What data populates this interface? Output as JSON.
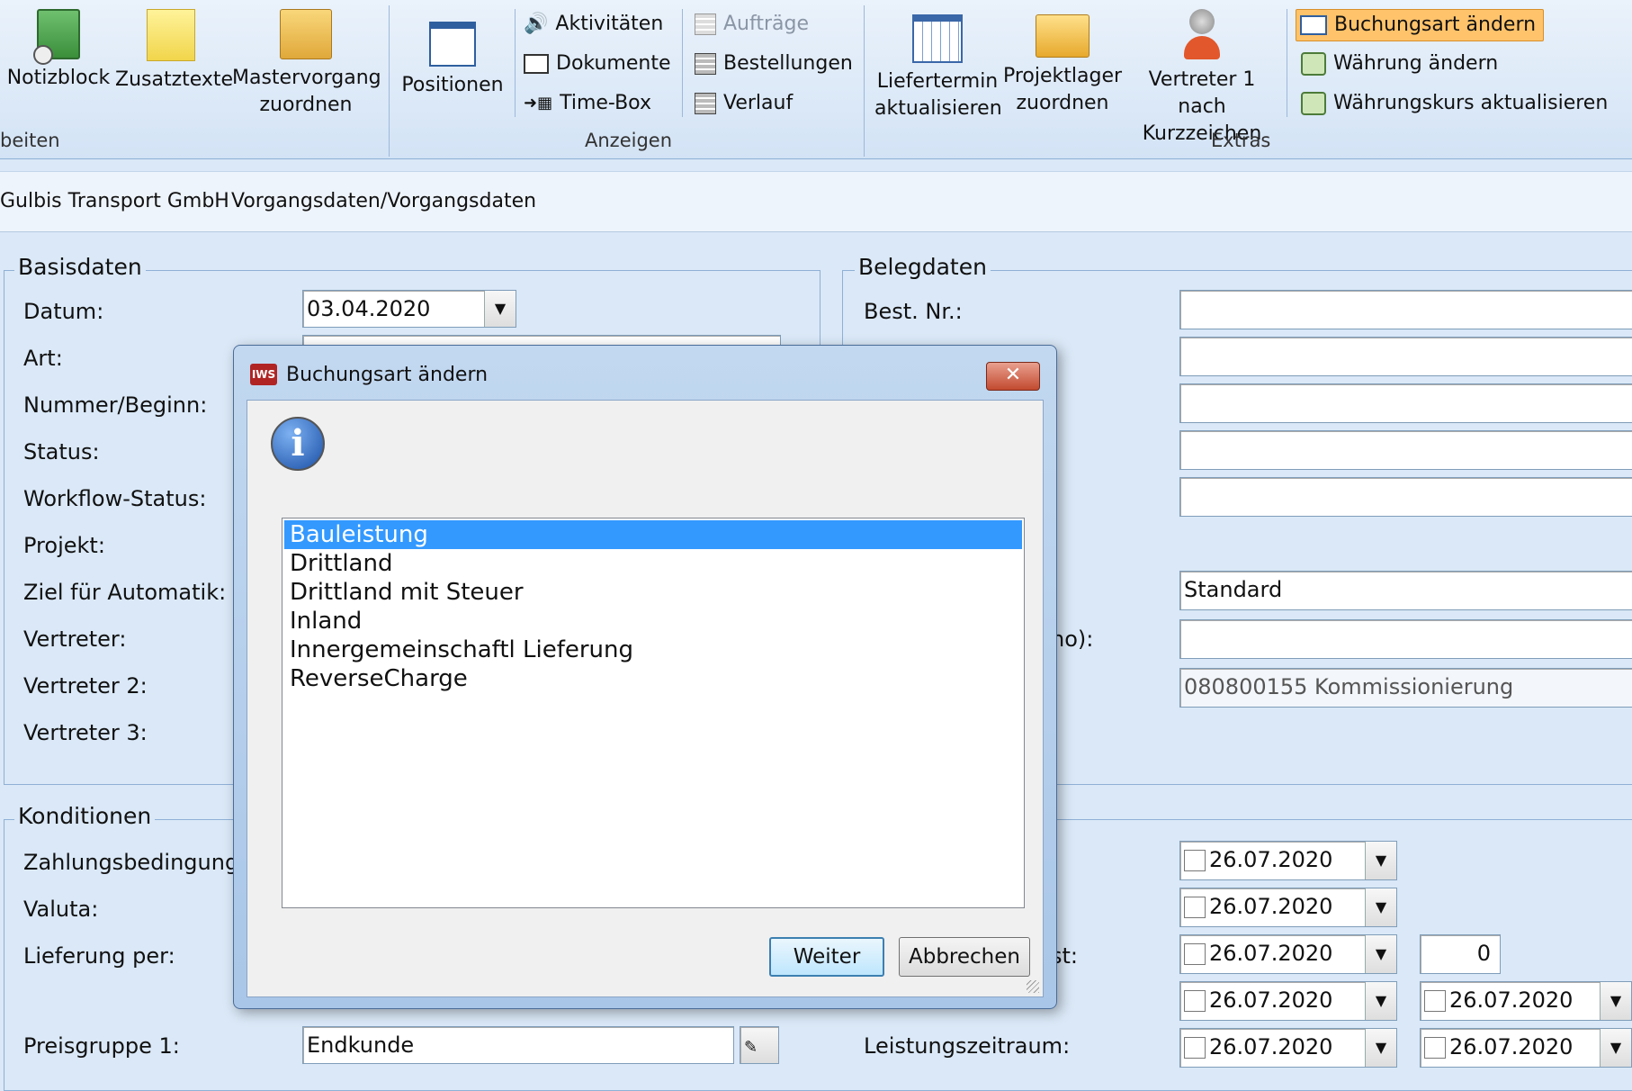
{
  "ribbon": {
    "large": {
      "notizblock": "Notizblock",
      "zusatztexte": "Zusatztexte",
      "mastervorgang_l1": "Mastervorgang",
      "mastervorgang_l2": "zuordnen",
      "positionen": "Positionen",
      "liefertermin_l1": "Liefertermin",
      "liefertermin_l2": "aktualisieren",
      "projektlager_l1": "Projektlager",
      "projektlager_l2": "zuordnen",
      "vertreter_l1": "Vertreter 1 nach",
      "vertreter_l2": "Kurzzeichen"
    },
    "anzeigen": {
      "aktivitaeten": "Aktivitäten",
      "dokumente": "Dokumente",
      "timebox": "Time-Box",
      "auftraege": "Aufträge",
      "bestellungen": "Bestellungen",
      "verlauf": "Verlauf"
    },
    "extras": {
      "buchungsart": "Buchungsart ändern",
      "waehrung": "Währung ändern",
      "waehrungskurs": "Währungskurs aktualisieren"
    },
    "groups": {
      "bearbeiten": "beiten",
      "anzeigen": "Anzeigen",
      "extras": "Extras"
    }
  },
  "breadcrumb": {
    "company": "Gulbis Transport GmbH",
    "path": "Vorgangsdaten/Vorgangsdaten"
  },
  "basisdaten": {
    "title": "Basisdaten",
    "labels": [
      "Datum:",
      "Art:",
      "Nummer/Beginn:",
      "Status:",
      "Workflow-Status:",
      "Projekt:",
      "Ziel für Automatik:",
      "Vertreter:",
      "Vertreter 2:",
      "Vertreter 3:"
    ],
    "datum": "03.04.2020"
  },
  "belegdaten": {
    "title": "Belegdaten",
    "best_nr": "Best. Nr.:",
    "partial_label": "no):",
    "standard": "Standard",
    "kommission": "080800155 Kommissionierung"
  },
  "konditionen": {
    "title": "Konditionen",
    "labels": [
      "Zahlungsbedingung:",
      "Valuta:",
      "Lieferung per:",
      "Preisgruppe 1:"
    ],
    "preisgruppe": "Endkunde",
    "partial_label": "st:",
    "leistungszeitraum": "Leistungszeitraum:",
    "dates": [
      "26.07.2020",
      "26.07.2020",
      "26.07.2020",
      "26.07.2020",
      "26.07.2020"
    ],
    "right_dates": [
      "26.07.2020",
      "26.07.2020"
    ],
    "zero": "0"
  },
  "dialog": {
    "title": "Buchungsart ändern",
    "options": [
      "Bauleistung",
      "Drittland",
      "Drittland mit Steuer",
      "Inland",
      "Innergemeinschaftl Lieferung",
      "ReverseCharge"
    ],
    "selected": "Bauleistung",
    "weiter": "Weiter",
    "abbrechen": "Abbrechen"
  },
  "colors": {
    "highlight": "#ffc36b",
    "selection": "#3399ff",
    "background": "#dae8f7"
  }
}
